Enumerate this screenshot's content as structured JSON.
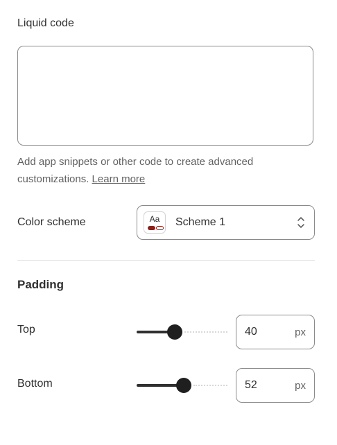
{
  "liquid": {
    "label": "Liquid code",
    "value": "",
    "help_text": "Add app snippets or other code to create advanced customizations.",
    "help_link": "Learn more"
  },
  "color_scheme": {
    "label": "Color scheme",
    "swatch_text": "Aa",
    "selected": "Scheme 1",
    "swatch_colors": {
      "text": "#303030",
      "primary": "#8c1f17",
      "secondary": "#8c1f17"
    }
  },
  "padding": {
    "title": "Padding",
    "top": {
      "label": "Top",
      "value": "40",
      "unit": "px",
      "level": 0.42
    },
    "bottom": {
      "label": "Bottom",
      "value": "52",
      "unit": "px",
      "level": 0.52
    }
  },
  "icons": {
    "scheme_select": "chevron-up-down-icon"
  }
}
